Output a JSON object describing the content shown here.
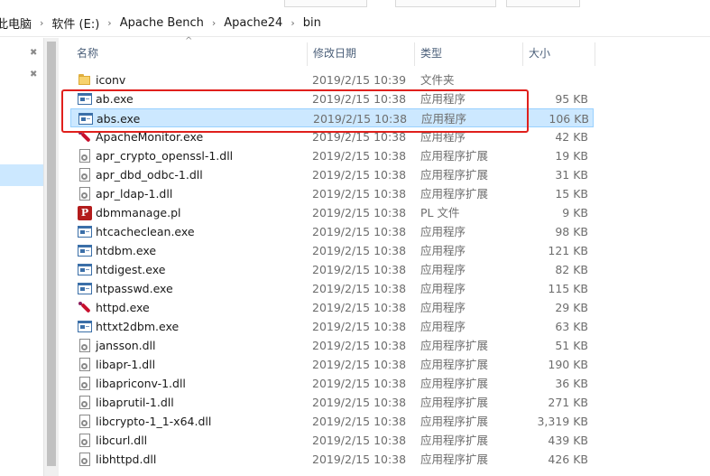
{
  "breadcrumb": [
    "此电脑",
    "软件 (E:)",
    "Apache Bench",
    "Apache24",
    "bin"
  ],
  "columns": {
    "name": "名称",
    "date": "修改日期",
    "type": "类型",
    "size": "大小"
  },
  "files": [
    {
      "name": "iconv",
      "date": "2019/2/15 10:39",
      "type": "文件夹",
      "size": "",
      "icon": "folder-icon"
    },
    {
      "name": "ab.exe",
      "date": "2019/2/15 10:38",
      "type": "应用程序",
      "size": "95 KB",
      "icon": "exe-icon"
    },
    {
      "name": "abs.exe",
      "date": "2019/2/15 10:38",
      "type": "应用程序",
      "size": "106 KB",
      "icon": "exe-icon",
      "selected": true
    },
    {
      "name": "ApacheMonitor.exe",
      "date": "2019/2/15 10:38",
      "type": "应用程序",
      "size": "42 KB",
      "icon": "apache-feather-icon"
    },
    {
      "name": "apr_crypto_openssl-1.dll",
      "date": "2019/2/15 10:38",
      "type": "应用程序扩展",
      "size": "19 KB",
      "icon": "dll-icon"
    },
    {
      "name": "apr_dbd_odbc-1.dll",
      "date": "2019/2/15 10:38",
      "type": "应用程序扩展",
      "size": "31 KB",
      "icon": "dll-icon"
    },
    {
      "name": "apr_ldap-1.dll",
      "date": "2019/2/15 10:38",
      "type": "应用程序扩展",
      "size": "15 KB",
      "icon": "dll-icon"
    },
    {
      "name": "dbmmanage.pl",
      "date": "2019/2/15 10:38",
      "type": "PL 文件",
      "size": "9 KB",
      "icon": "perl-file-icon"
    },
    {
      "name": "htcacheclean.exe",
      "date": "2019/2/15 10:38",
      "type": "应用程序",
      "size": "98 KB",
      "icon": "exe-icon"
    },
    {
      "name": "htdbm.exe",
      "date": "2019/2/15 10:38",
      "type": "应用程序",
      "size": "121 KB",
      "icon": "exe-icon"
    },
    {
      "name": "htdigest.exe",
      "date": "2019/2/15 10:38",
      "type": "应用程序",
      "size": "82 KB",
      "icon": "exe-icon"
    },
    {
      "name": "htpasswd.exe",
      "date": "2019/2/15 10:38",
      "type": "应用程序",
      "size": "115 KB",
      "icon": "exe-icon"
    },
    {
      "name": "httpd.exe",
      "date": "2019/2/15 10:38",
      "type": "应用程序",
      "size": "29 KB",
      "icon": "apache-feather-icon"
    },
    {
      "name": "httxt2dbm.exe",
      "date": "2019/2/15 10:38",
      "type": "应用程序",
      "size": "63 KB",
      "icon": "exe-icon"
    },
    {
      "name": "jansson.dll",
      "date": "2019/2/15 10:38",
      "type": "应用程序扩展",
      "size": "51 KB",
      "icon": "dll-icon"
    },
    {
      "name": "libapr-1.dll",
      "date": "2019/2/15 10:38",
      "type": "应用程序扩展",
      "size": "190 KB",
      "icon": "dll-icon"
    },
    {
      "name": "libapriconv-1.dll",
      "date": "2019/2/15 10:38",
      "type": "应用程序扩展",
      "size": "36 KB",
      "icon": "dll-icon"
    },
    {
      "name": "libaprutil-1.dll",
      "date": "2019/2/15 10:38",
      "type": "应用程序扩展",
      "size": "271 KB",
      "icon": "dll-icon"
    },
    {
      "name": "libcrypto-1_1-x64.dll",
      "date": "2019/2/15 10:38",
      "type": "应用程序扩展",
      "size": "3,319 KB",
      "icon": "dll-icon"
    },
    {
      "name": "libcurl.dll",
      "date": "2019/2/15 10:38",
      "type": "应用程序扩展",
      "size": "439 KB",
      "icon": "dll-icon"
    },
    {
      "name": "libhttpd.dll",
      "date": "2019/2/15 10:38",
      "type": "应用程序扩展",
      "size": "426 KB",
      "icon": "dll-icon"
    }
  ],
  "colors": {
    "selection": "#cce8ff",
    "selection_border": "#99d1ff",
    "annotation": "#e0201c",
    "header_text": "#4c607a"
  }
}
